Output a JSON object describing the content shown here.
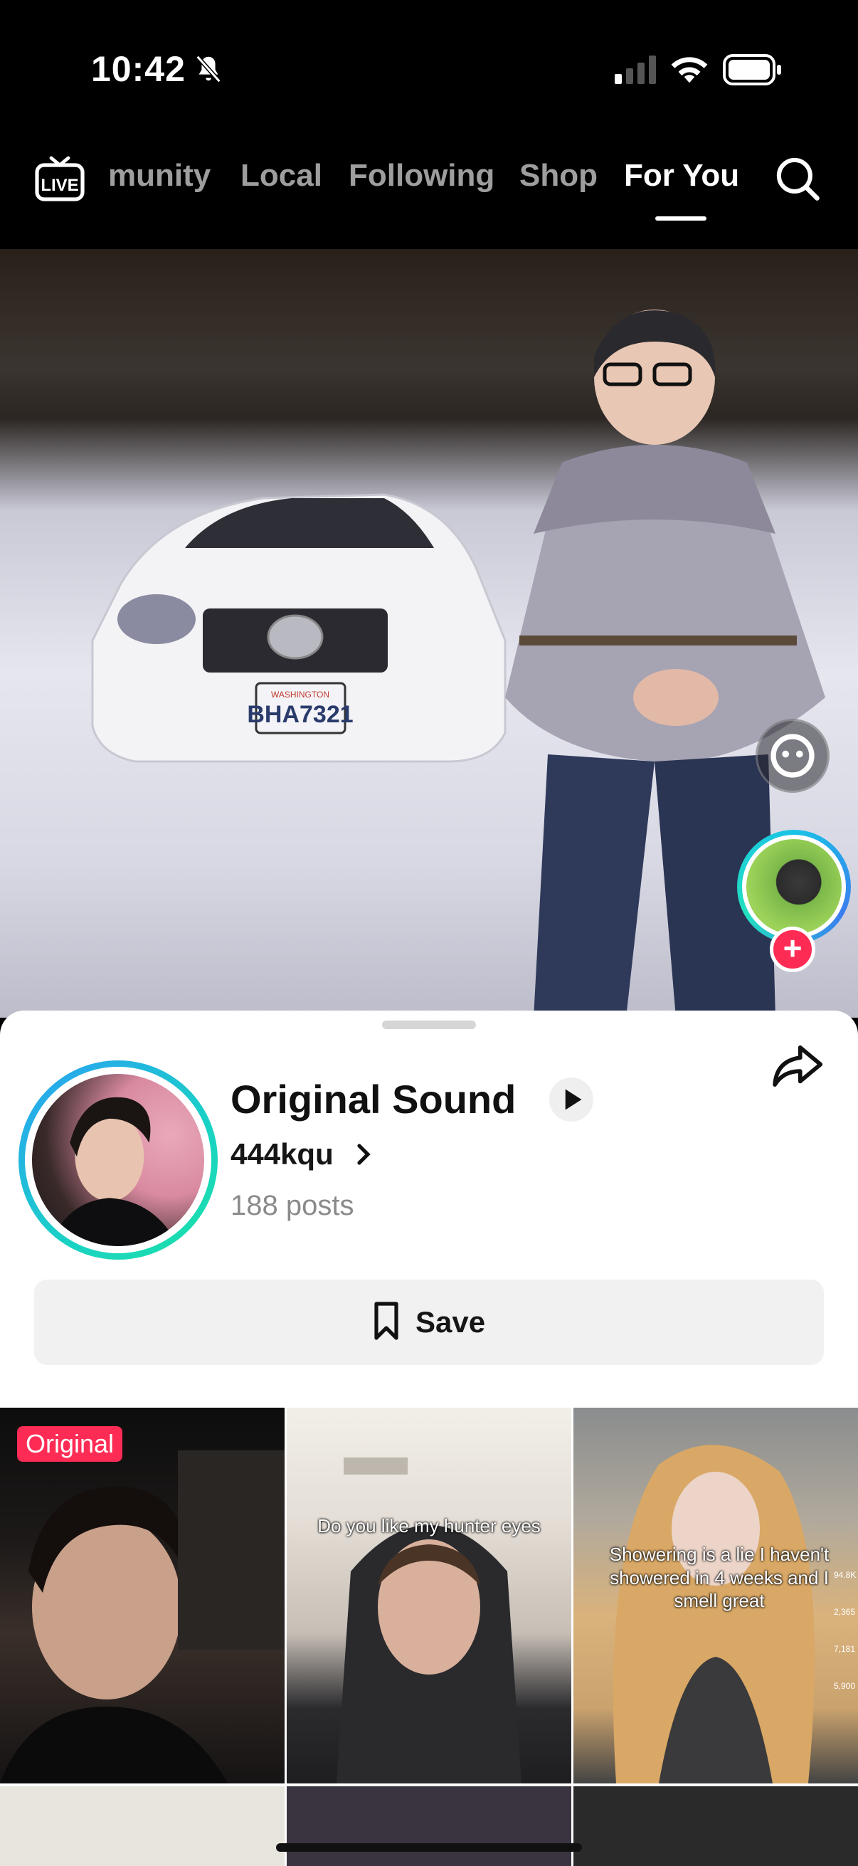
{
  "status_bar": {
    "time": "10:42"
  },
  "top_nav": {
    "live_label": "LIVE",
    "tabs": [
      "munity",
      "Local",
      "Following",
      "Shop",
      "For You"
    ],
    "active_tab": "For You"
  },
  "video": {
    "license_plate_state": "WASHINGTON",
    "license_plate": "BHA7321"
  },
  "sound_sheet": {
    "title": "Original Sound",
    "author": "444kqu",
    "post_count": "188 posts",
    "save_label": "Save"
  },
  "grid": {
    "items": [
      {
        "badge": "Original",
        "overlay": ""
      },
      {
        "badge": "",
        "overlay": "Do you like my hunter eyes"
      },
      {
        "badge": "",
        "overlay": "Showering is a lie I haven't showered in 4 weeks and I smell great",
        "side_counts": [
          "94.8K",
          "2,365",
          "7,181",
          "5,900"
        ]
      }
    ]
  },
  "colors": {
    "accent": "#fe2c55",
    "ring_start": "#2aa0f5",
    "ring_end": "#19e3a6"
  }
}
